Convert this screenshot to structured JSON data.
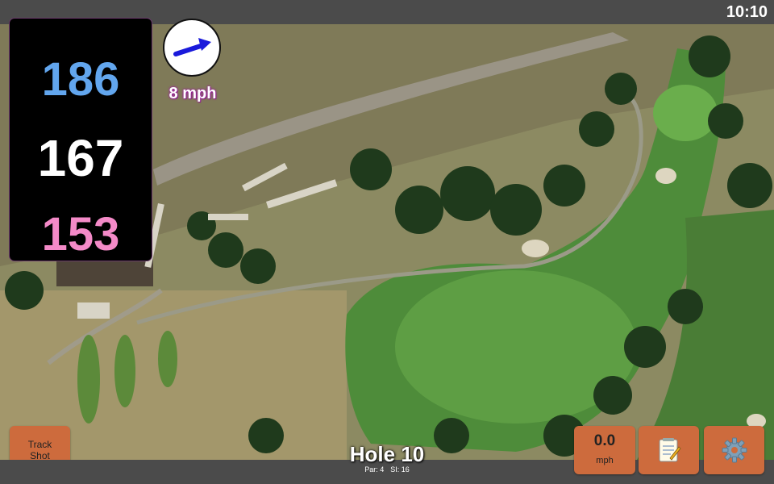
{
  "status": {
    "time": "10:10"
  },
  "distances": {
    "back": "186",
    "middle": "167",
    "front": "153"
  },
  "wind": {
    "speed_label": "8 mph",
    "icon": "wind-arrow-icon"
  },
  "buttons": {
    "track_shot_line1": "Track",
    "track_shot_line2": "Shot",
    "speed_value": "0.0",
    "speed_unit": "mph",
    "notes_icon": "notepad-icon",
    "settings_icon": "gear-icon"
  },
  "hole": {
    "title": "Hole 10",
    "par": "Par: 4",
    "si": "SI: 16"
  },
  "colors": {
    "accent_button": "#cd6b3d",
    "back_distance": "#62a6ee",
    "front_distance": "#f48ac8",
    "wind_arrow": "#1a1adb"
  }
}
